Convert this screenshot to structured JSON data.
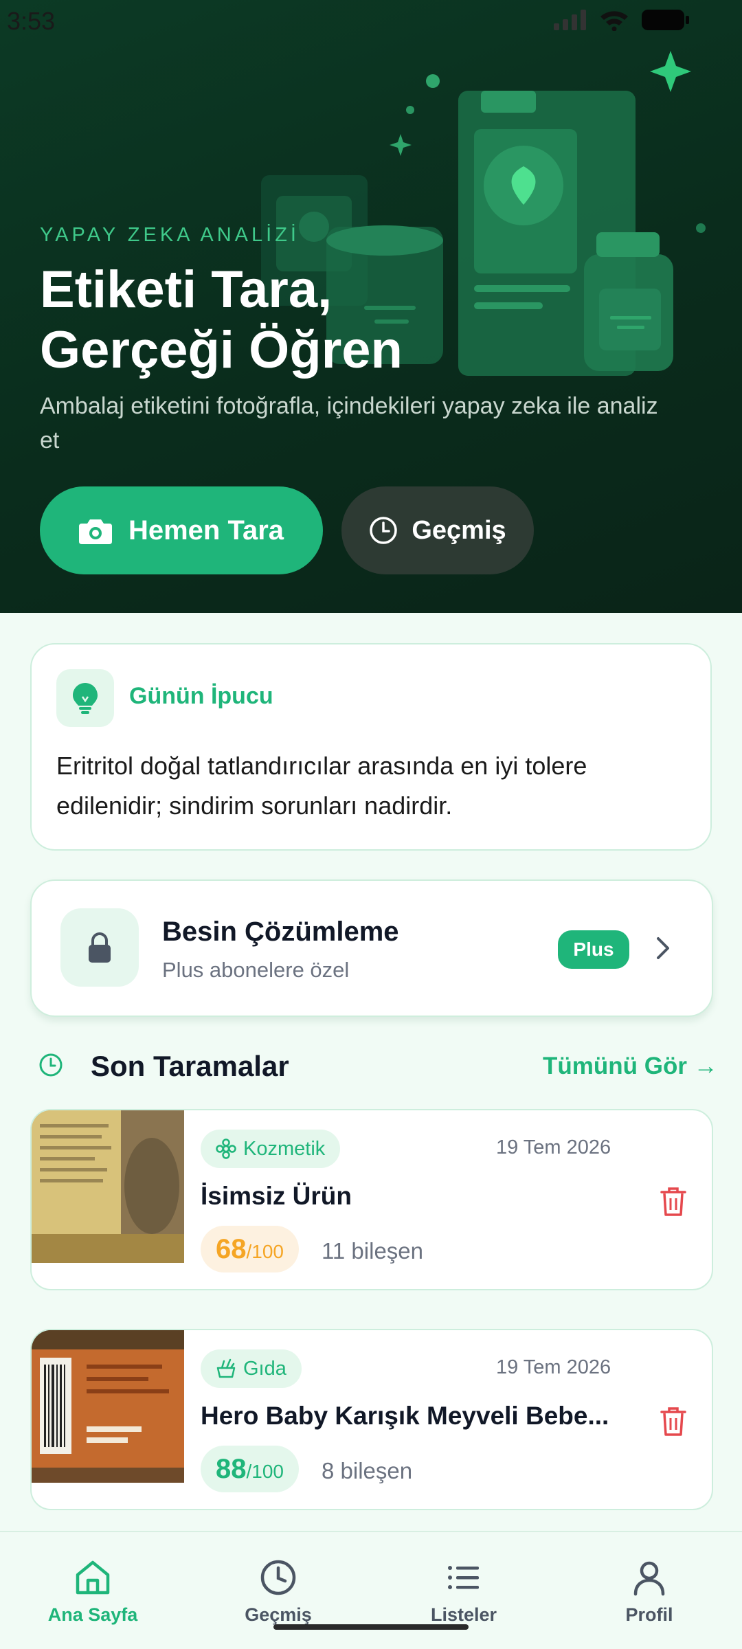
{
  "status_bar": {
    "time": "3:53"
  },
  "hero": {
    "eyebrow": "YAPAY ZEKA ANALİZİ",
    "title_line1": "Etiketi Tara,",
    "title_line2": "Gerçeği Öğren",
    "subtitle": "Ambalaj etiketini fotoğrafla, içindekileri yapay zeka ile analiz et",
    "scan_button": "Hemen Tara",
    "history_button": "Geçmiş"
  },
  "tip": {
    "title": "Günün İpucu",
    "text": "Eritritol doğal tatlandırıcılar arasında en iyi tolere edilenidir; sindirim sorunları nadirdir."
  },
  "plus_feature": {
    "title": "Besin Çözümleme",
    "subtitle": "Plus abonelere özel",
    "badge": "Plus"
  },
  "recent": {
    "title": "Son Taramalar",
    "see_all": "Tümünü Gör →",
    "items": [
      {
        "category": "Kozmetik",
        "date": "19 Tem 2026",
        "name": "İsimsiz Ürün",
        "score": "68",
        "score_max": "/100",
        "components": "11 bileşen",
        "score_color": "#f5a524",
        "score_bg": "#fdf1e0"
      },
      {
        "category": "Gıda",
        "date": "19 Tem 2026",
        "name": "Hero Baby Karışık Meyveli Bebe...",
        "score": "88",
        "score_max": "/100",
        "components": "8 bileşen",
        "score_color": "#1fb57a",
        "score_bg": "#e4f7ec"
      }
    ]
  },
  "nav": {
    "items": [
      {
        "label": "Ana Sayfa",
        "active": true
      },
      {
        "label": "Geçmiş",
        "active": false
      },
      {
        "label": "Listeler",
        "active": false
      },
      {
        "label": "Profil",
        "active": false
      }
    ]
  },
  "colors": {
    "accent": "#1fb57a",
    "hero_bg": "#0a2c1c",
    "danger": "#e5484d",
    "page_bg": "#f1fbf5"
  }
}
